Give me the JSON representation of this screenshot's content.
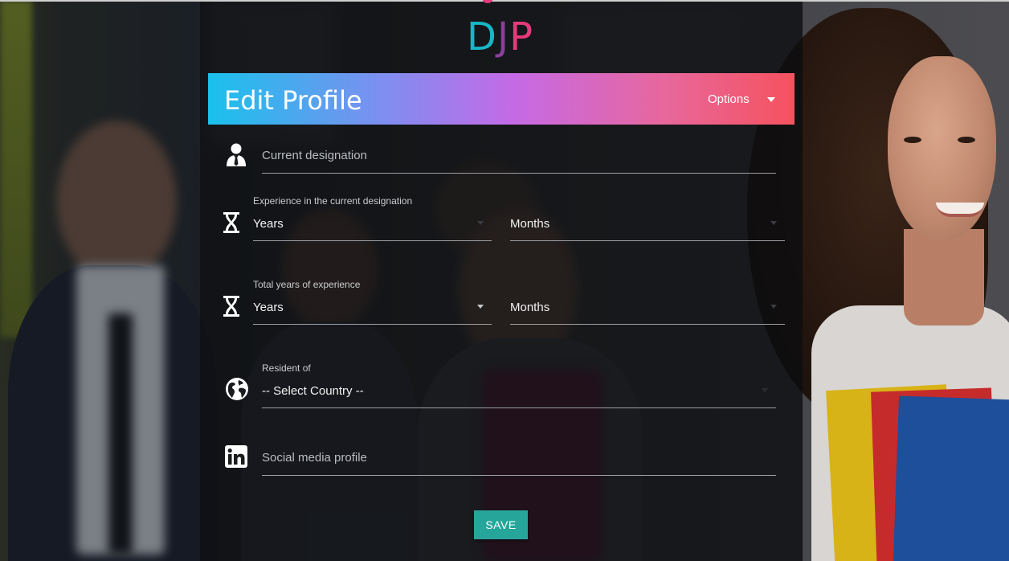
{
  "logo": {
    "d": "D",
    "j": "J",
    "p": "P"
  },
  "header": {
    "title": "Edit Profile",
    "options_label": "Options",
    "gradient_colors": [
      "#19c1ec",
      "#c56ae6",
      "#f5525e"
    ]
  },
  "form": {
    "designation": {
      "placeholder": "Current designation",
      "icon": "user-tie-icon"
    },
    "current_experience": {
      "label": "Experience in the current designation",
      "icon": "hourglass-icon",
      "years": "Years",
      "months": "Months"
    },
    "total_experience": {
      "label": "Total years of experience",
      "icon": "hourglass-icon",
      "years": "Years",
      "months": "Months"
    },
    "resident": {
      "label": "Resident of",
      "icon": "globe-icon",
      "value": "-- Select Country --"
    },
    "social": {
      "placeholder": "Social media profile",
      "icon": "linkedin-icon"
    },
    "save_label": "SAVE"
  },
  "colors": {
    "save_button": "#26a69a"
  }
}
